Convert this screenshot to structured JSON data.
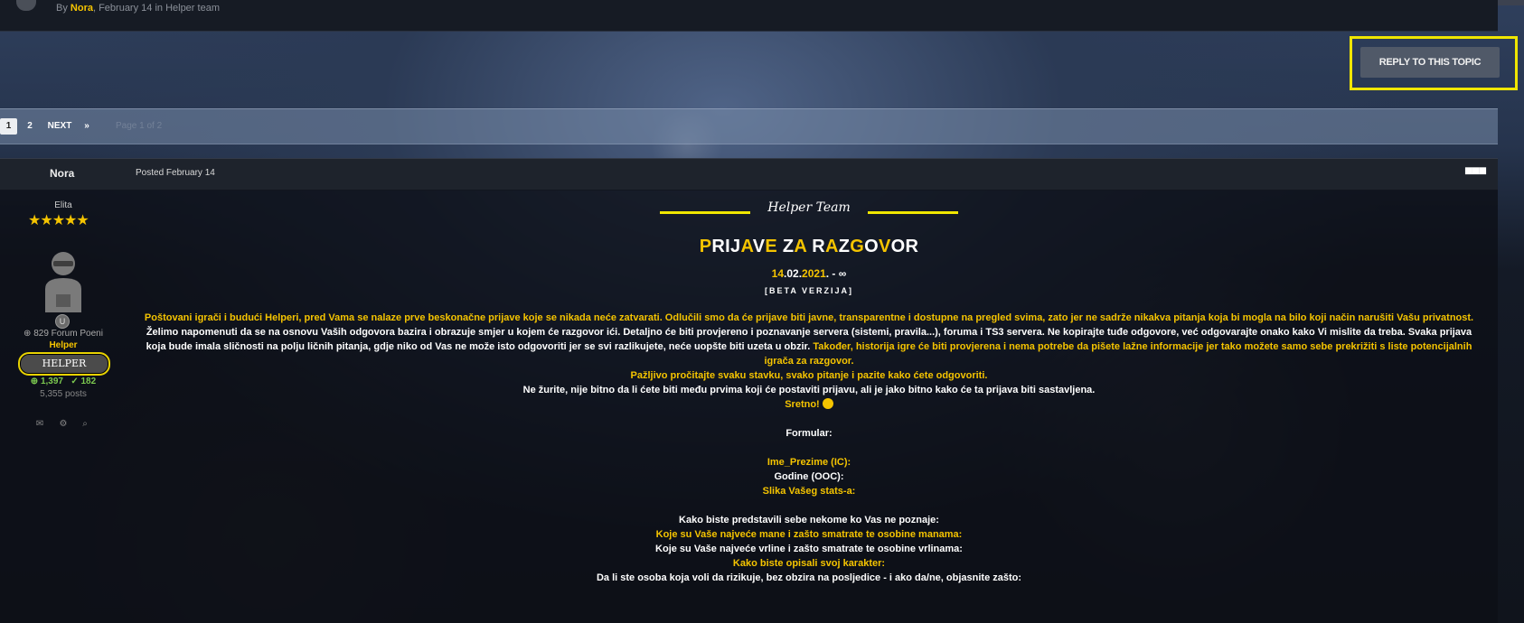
{
  "prev_post": {
    "by": "By ",
    "author": "Nora",
    "meta": ", February 14 in Helper team"
  },
  "reply_button": {
    "label": "REPLY TO THIS TOPIC"
  },
  "pagination": {
    "pages": [
      "1",
      "2"
    ],
    "next": "NEXT",
    "last_icon": "»",
    "page_of": "Page 1 of 2"
  },
  "post": {
    "author": "Nora",
    "date": "Posted February 14",
    "menu_icon": "ellipsis-icon",
    "author_info": {
      "rank_title": "Elita",
      "stars": "★★★★★",
      "forum_points": "829 Forum Poeni",
      "group": "Helper",
      "badge": "HELPER",
      "rep_positive": "1,397",
      "rep_solved": "182",
      "posts": "5,355 posts",
      "rep_badge": "U"
    },
    "content": {
      "team_name": "Helper Team",
      "headline": [
        "P",
        "R",
        "I",
        "J",
        "A",
        "V",
        "E",
        " ",
        "Z",
        "A",
        " ",
        "R",
        "A",
        "Z",
        "G",
        "O",
        "V",
        "O",
        "R"
      ],
      "headline_yellow": [
        true,
        false,
        false,
        false,
        true,
        false,
        true,
        false,
        false,
        true,
        false,
        false,
        true,
        false,
        true,
        false,
        true,
        false,
        false
      ],
      "date_a": "14",
      "date_b": ".02.",
      "date_c": "2021",
      "date_d": ". - ∞",
      "beta": "[BETA VERZIJA]",
      "p1_y": "Poštovani igrači i budući Helperi, pred Vama se nalaze prve beskonačne prijave koje se nikada neće zatvarati. Odlučili smo da će prijave biti javne, transparentne i dostupne na pregled svima, zato jer ne sadrže nikakva pitanja koja bi mogla na bilo koji način narušiti Vašu privatnost.",
      "p2_w": "Želimo napomenuti da se na osnovu Vaših odgovora bazira i obrazuje smjer u kojem će razgovor ići. Detaljno će biti provjereno i poznavanje servera (sistemi, pravila...), foruma i TS3 servera. Ne kopirajte tuđe odgovore, već odgovarajte onako kako Vi mislite da treba. Svaka prijava",
      "p3_w": "koja bude imala sličnosti na polju ličnih pitanja, gdje niko od Vas ne može isto odgovoriti jer se svi razlikujete, neće uopšte biti uzeta u obzir.",
      "p3_y": " Također, historija igre će biti provjerena i nema potrebe da pišete lažne informacije jer tako možete samo sebe prekrižiti s liste potencijalnih",
      "p4_y": "igrača za razgovor.",
      "p5_y": "Pažljivo pročitajte svaku stavku, svako pitanje i pazite kako ćete odgovoriti.",
      "p6_w": "Ne žurite, nije bitno da li ćete biti među prvima koji će postaviti prijavu, ali je jako bitno kako će ta prijava biti sastavljena.",
      "p7_y": "Sretno!",
      "formular": "Formular:",
      "f1": "Ime_Prezime (IC):",
      "f2": "Godine (OOC):",
      "f3": "Slika Vašeg stats-a:",
      "q1": "Kako biste predstavili sebe nekome ko Vas ne poznaje:",
      "q2": "Koje su Vaše najveće mane i zašto smatrate te osobine manama:",
      "q3": "Koje su Vaše najveće vrline i zašto smatrate te osobine vrlinama:",
      "q4": "Kako biste opisali svoj karakter:",
      "q5": "Da li ste osoba koja voli da rizikuje, bez obzira na posljedice - i ako da/ne, objasnite zašto:"
    }
  },
  "colors": {
    "accent": "#f5c400",
    "highlight_box": "#f0e600",
    "button": "#505968"
  }
}
